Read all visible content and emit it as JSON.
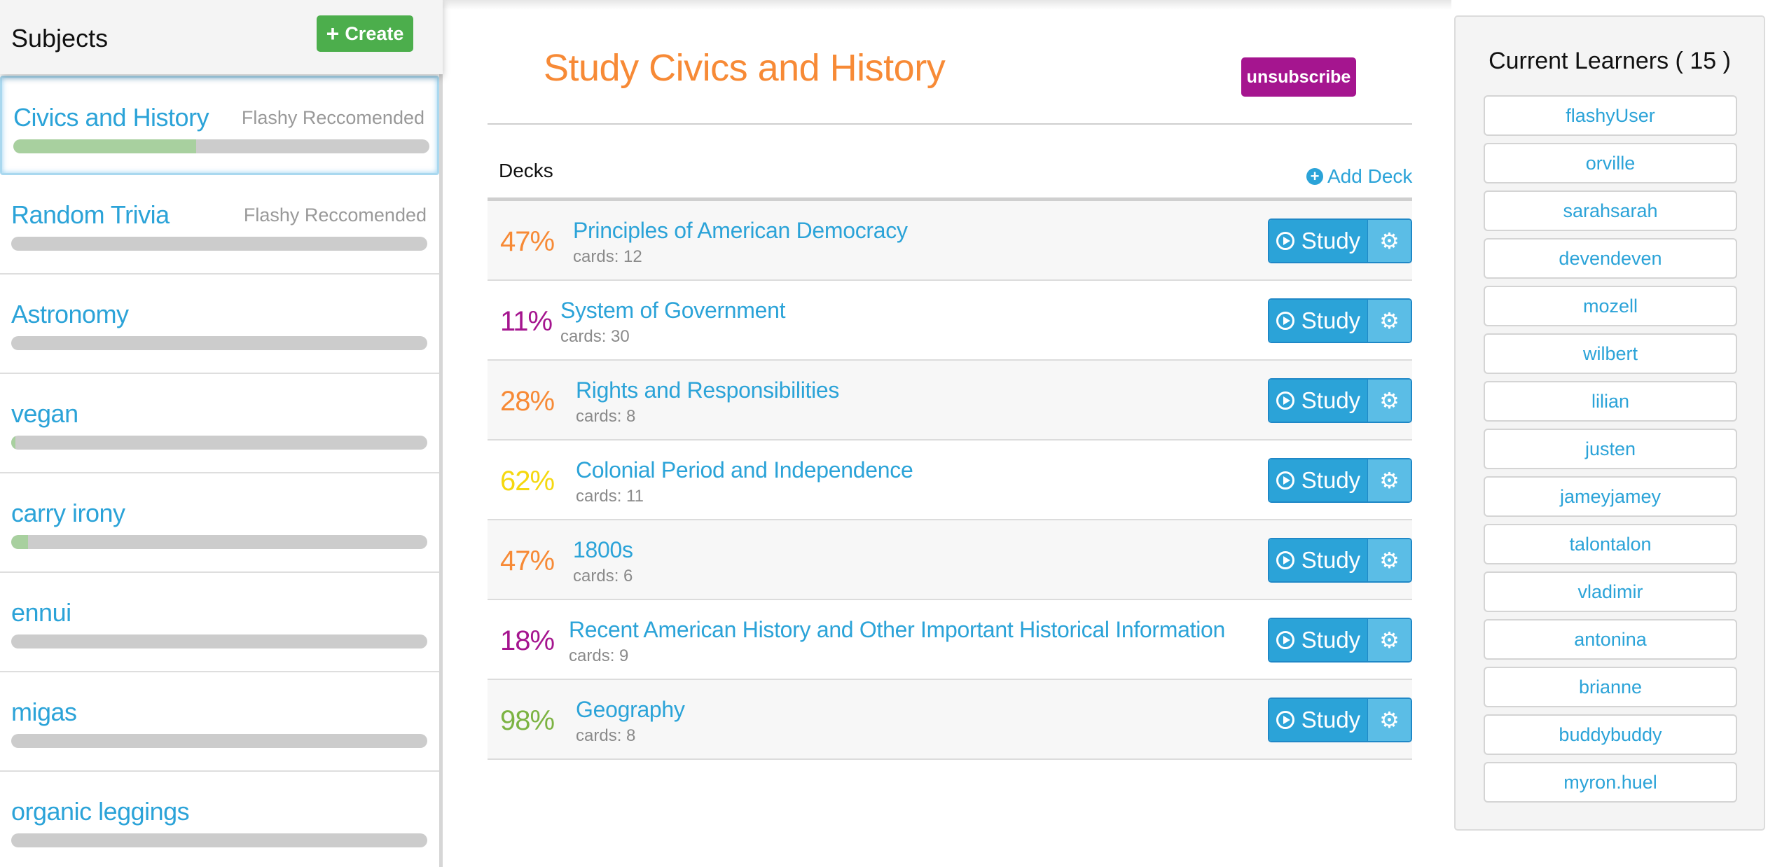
{
  "sidebar": {
    "title": "Subjects",
    "create_label": "Create",
    "subjects": [
      {
        "name": "Civics and History",
        "tag": "Flashy Reccomended",
        "progress": 0.44,
        "active": true
      },
      {
        "name": "Random Trivia",
        "tag": "Flashy Reccomended",
        "progress": 0.0,
        "active": false
      },
      {
        "name": "Astronomy",
        "tag": "",
        "progress": 0.0,
        "active": false
      },
      {
        "name": "vegan",
        "tag": "",
        "progress": 0.01,
        "active": false
      },
      {
        "name": "carry irony",
        "tag": "",
        "progress": 0.04,
        "active": false
      },
      {
        "name": "ennui",
        "tag": "",
        "progress": 0.0,
        "active": false
      },
      {
        "name": "migas",
        "tag": "",
        "progress": 0.0,
        "active": false
      },
      {
        "name": "organic leggings",
        "tag": "",
        "progress": 0.0,
        "active": false
      }
    ]
  },
  "main": {
    "title": "Study Civics and History",
    "unsubscribe_label": "unsubscribe",
    "decks_label": "Decks",
    "add_deck_label": "Add Deck",
    "study_label": "Study",
    "decks": [
      {
        "percent": "47%",
        "color": "#f78a36",
        "name": "Principles of American Democracy",
        "cards": "cards: 12"
      },
      {
        "percent": "11%",
        "color": "#a5158f",
        "name": "System of Government",
        "cards": "cards: 30"
      },
      {
        "percent": "28%",
        "color": "#f78a36",
        "name": "Rights and Responsibilities",
        "cards": "cards: 8"
      },
      {
        "percent": "62%",
        "color": "#f5d80f",
        "name": "Colonial Period and Independence",
        "cards": "cards: 11"
      },
      {
        "percent": "47%",
        "color": "#f78a36",
        "name": "1800s",
        "cards": "cards: 6"
      },
      {
        "percent": "18%",
        "color": "#a5158f",
        "name": "Recent American History and Other Important Historical Information",
        "cards": "cards: 9"
      },
      {
        "percent": "98%",
        "color": "#7cb342",
        "name": "Geography",
        "cards": "cards: 8"
      }
    ]
  },
  "learners": {
    "title": "Current Learners ( 15 )",
    "names": [
      "flashyUser",
      "orville",
      "sarahsarah",
      "devendeven",
      "mozell",
      "wilbert",
      "lilian",
      "justen",
      "jameyjamey",
      "talontalon",
      "vladimir",
      "antonina",
      "brianne",
      "buddybuddy",
      "myron.huel"
    ]
  },
  "colors": {
    "accent_blue": "#2ba3d8",
    "title_orange": "#f78a36",
    "create_green": "#4cae4c",
    "unsubscribe_purple": "#a5158f"
  },
  "icons": {
    "create": "plus-icon",
    "add_deck": "plus-circle-icon",
    "study": "play-circle-icon",
    "settings": "gear-icon"
  }
}
